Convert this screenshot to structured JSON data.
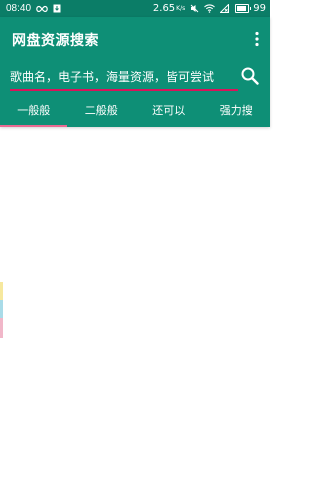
{
  "status_bar": {
    "time": "08:40",
    "speed": "2.65",
    "speed_unit": "K/s",
    "battery": "99",
    "icons": [
      "infinity-icon",
      "download-icon",
      "volume-off-icon",
      "wifi-icon",
      "sim-x-icon",
      "battery-icon"
    ]
  },
  "app": {
    "title": "网盘资源搜索"
  },
  "search": {
    "placeholder": "歌曲名，电子书，海量资源，皆可尝试"
  },
  "tabs": [
    {
      "label": "一般般",
      "selected": true
    },
    {
      "label": "二般般",
      "selected": false
    },
    {
      "label": "还可以",
      "selected": false
    },
    {
      "label": "强力搜",
      "selected": false
    }
  ],
  "colors": {
    "status_bar_bg": "#0b7d67",
    "app_bar_bg": "#0e8f76",
    "accent": "#d9145b",
    "tab_indicator": "#e86a92"
  }
}
